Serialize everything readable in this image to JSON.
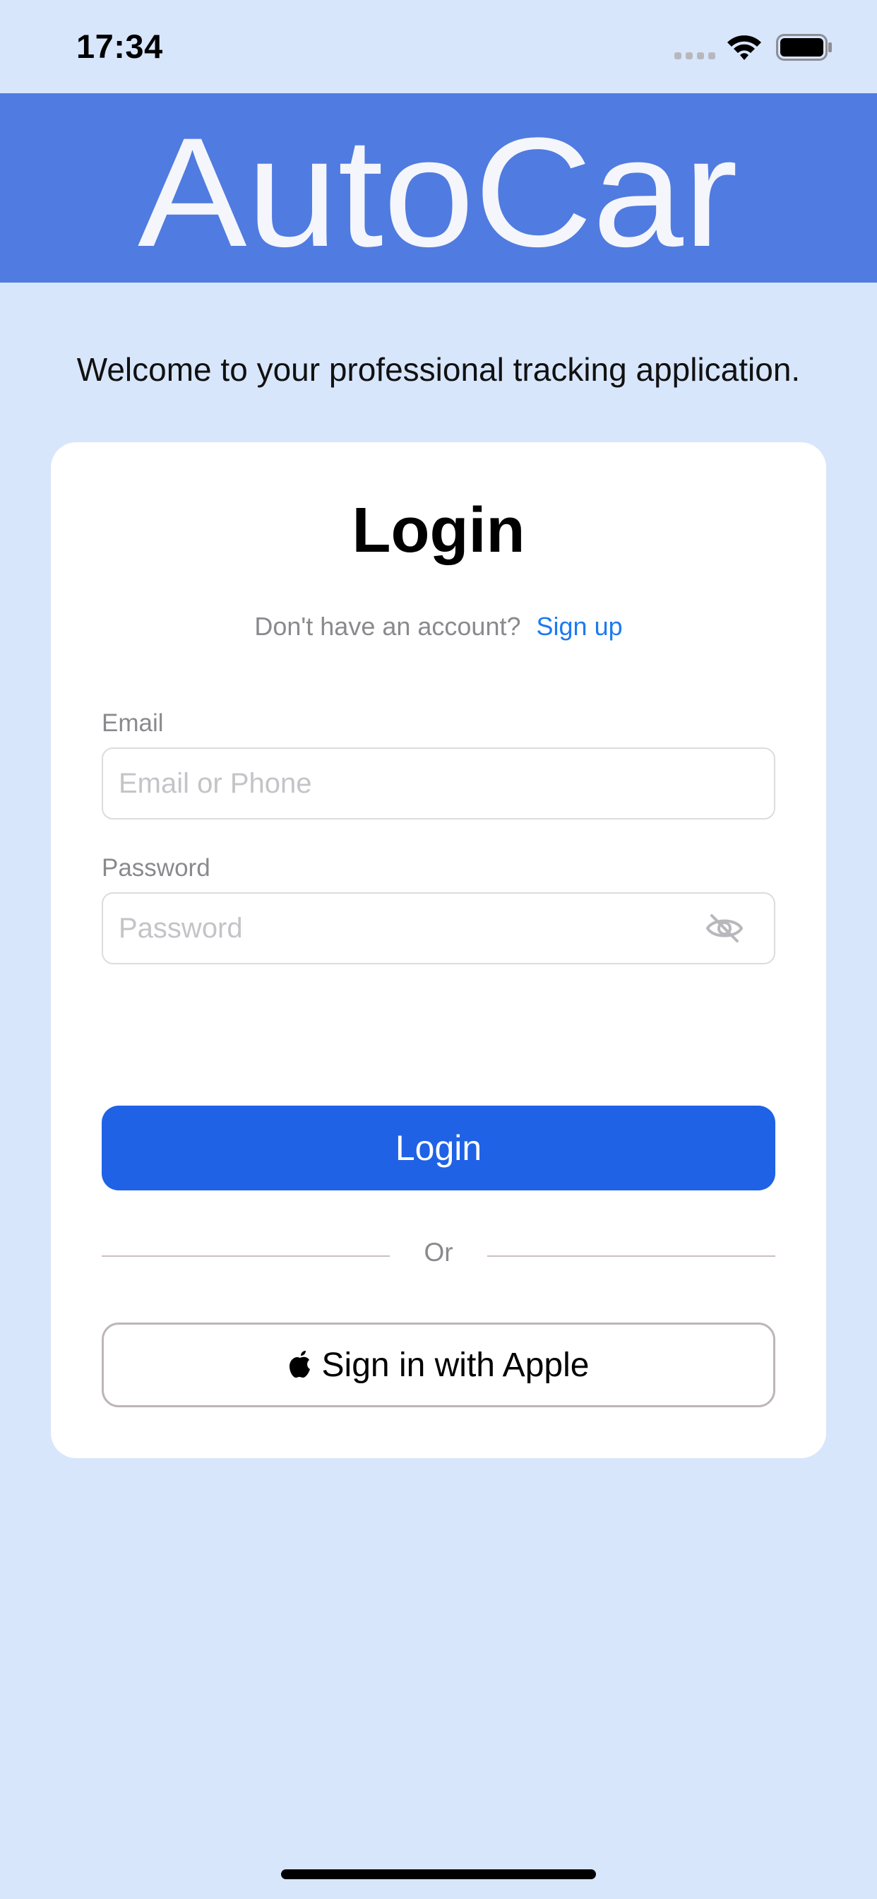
{
  "status_bar": {
    "time": "17:34",
    "signal_icon": "cellular-signal-icon",
    "wifi_icon": "wifi-icon",
    "battery_icon": "battery-icon"
  },
  "header": {
    "brand": "AutoCar",
    "background_color": "#507be0"
  },
  "welcome_text": "Welcome to your professional tracking application.",
  "login_card": {
    "title": "Login",
    "signup_prompt": "Don't have an account?",
    "signup_link": "Sign up",
    "email": {
      "label": "Email",
      "placeholder": "Email or Phone",
      "value": ""
    },
    "password": {
      "label": "Password",
      "placeholder": "Password",
      "value": "",
      "toggle_icon": "eye-slash-icon"
    },
    "login_button": "Login",
    "divider_text": "Or",
    "apple_button": "Sign in with Apple",
    "apple_icon": "apple-logo-icon"
  },
  "colors": {
    "page_background": "#d8e6fc",
    "primary_button": "#1f62e6",
    "link": "#1d7af0"
  }
}
